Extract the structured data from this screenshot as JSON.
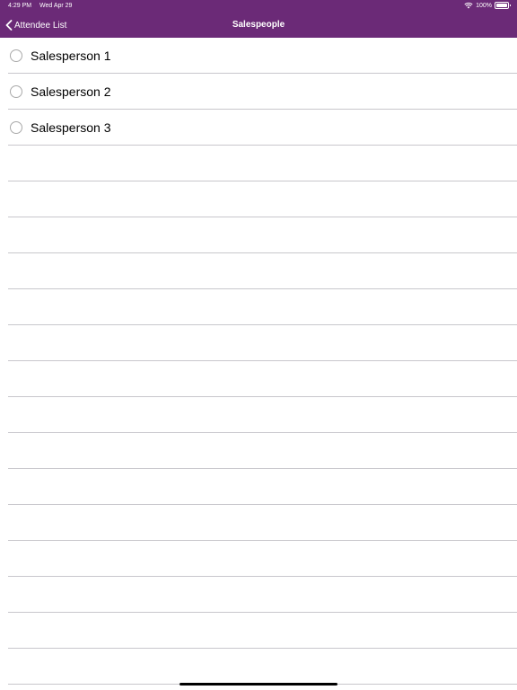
{
  "status_bar": {
    "time": "4:29 PM",
    "date": "Wed Apr 29",
    "battery": "100%"
  },
  "nav": {
    "back_label": "Attendee List",
    "title": "Salespeople"
  },
  "list": {
    "items": [
      {
        "label": "Salesperson 1",
        "selected": false
      },
      {
        "label": "Salesperson 2",
        "selected": false
      },
      {
        "label": "Salesperson 3",
        "selected": false
      }
    ],
    "empty_rows": 15
  },
  "colors": {
    "nav_background": "#6b2a77",
    "separator": "#c8c7cc",
    "radio_border": "#a9a9a9"
  }
}
